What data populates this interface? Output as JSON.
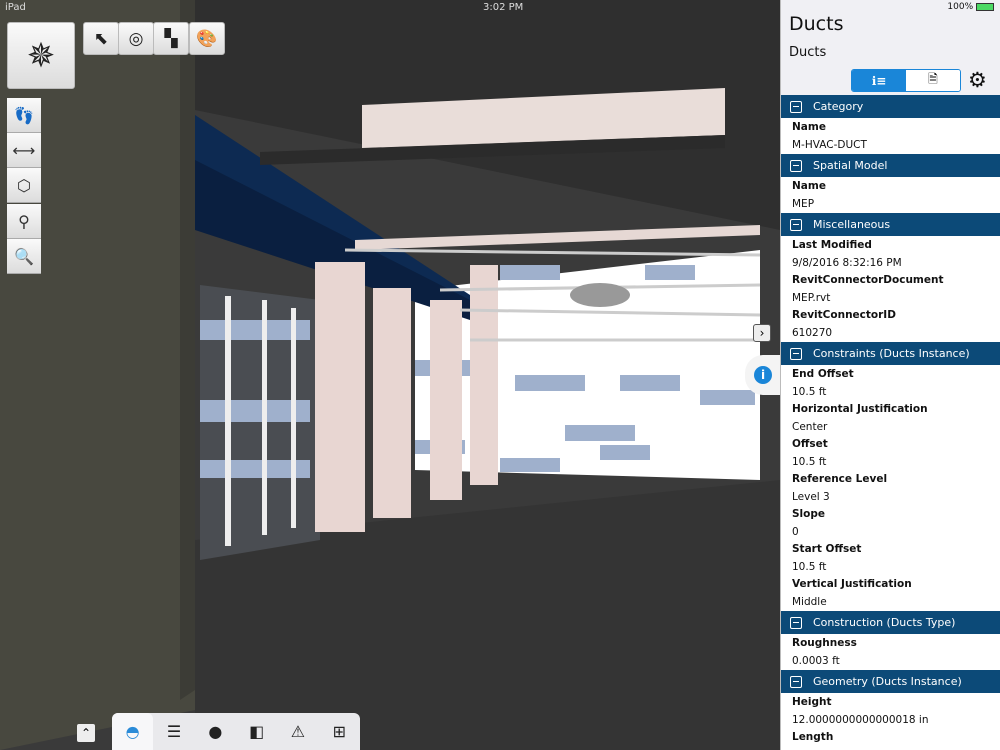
{
  "status_bar": {
    "device": "iPad",
    "time": "3:02 PM",
    "battery": "100%"
  },
  "toolbar": {
    "icons": [
      "select-region",
      "hide",
      "display-mode",
      "appearance"
    ]
  },
  "left_tools": [
    "walk",
    "measure",
    "section-box",
    "location",
    "search"
  ],
  "bottom_tabs": [
    "model-browser",
    "layers",
    "objects",
    "section",
    "issues",
    "hierarchy"
  ],
  "panel": {
    "title": "Ducts",
    "subtitle": "Ducts",
    "sections": [
      {
        "name": "Category",
        "props": [
          {
            "label": "Name",
            "value": "M-HVAC-DUCT"
          }
        ]
      },
      {
        "name": "Spatial Model",
        "props": [
          {
            "label": "Name",
            "value": "MEP"
          }
        ]
      },
      {
        "name": "Miscellaneous",
        "props": [
          {
            "label": "Last Modified",
            "value": "9/8/2016 8:32:16 PM"
          },
          {
            "label": "RevitConnectorDocument",
            "value": "MEP.rvt"
          },
          {
            "label": "RevitConnectorID",
            "value": "610270"
          }
        ]
      },
      {
        "name": "Constraints (Ducts Instance)",
        "props": [
          {
            "label": "End Offset",
            "value": "10.5 ft"
          },
          {
            "label": "Horizontal Justification",
            "value": "Center"
          },
          {
            "label": "Offset",
            "value": "10.5 ft"
          },
          {
            "label": "Reference Level",
            "value": "Level 3"
          },
          {
            "label": "Slope",
            "value": "0"
          },
          {
            "label": "Start Offset",
            "value": "10.5 ft"
          },
          {
            "label": "Vertical Justification",
            "value": "Middle"
          }
        ]
      },
      {
        "name": "Construction (Ducts Type)",
        "props": [
          {
            "label": "Roughness",
            "value": "0.0003 ft"
          }
        ]
      },
      {
        "name": "Geometry (Ducts Instance)",
        "props": [
          {
            "label": "Height",
            "value": "12.0000000000000018 in"
          },
          {
            "label": "Length",
            "value": ""
          }
        ]
      }
    ]
  },
  "colors": {
    "header": "#0c4a78",
    "accent": "#1a86d8"
  }
}
